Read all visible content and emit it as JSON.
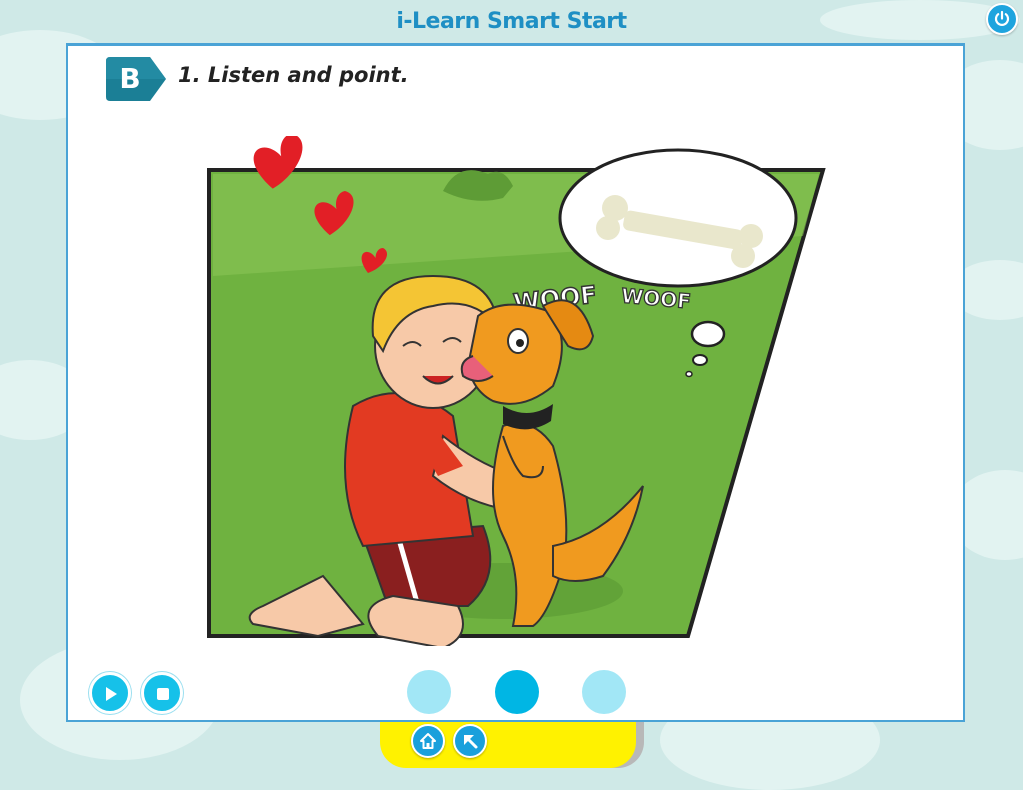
{
  "app": {
    "title": "i-Learn Smart Start"
  },
  "header": {
    "power_icon": "power-icon"
  },
  "lesson": {
    "section_letter": "B",
    "instruction": "1. Listen and point.",
    "badge_color": "#1b7f96"
  },
  "illustration": {
    "sound_text_1": "WOOF",
    "sound_text_2": "WOOF",
    "thought_object": "bone"
  },
  "audio_controls": {
    "play_icon": "play-icon",
    "stop_icon": "stop-icon"
  },
  "pagination": {
    "total": 3,
    "active_index": 2
  },
  "footer": {
    "home_icon": "home-icon",
    "back_icon": "back-arrow-icon"
  },
  "colors": {
    "accent": "#16c1e9",
    "title": "#1e8fc4",
    "footer": "#fff200"
  }
}
